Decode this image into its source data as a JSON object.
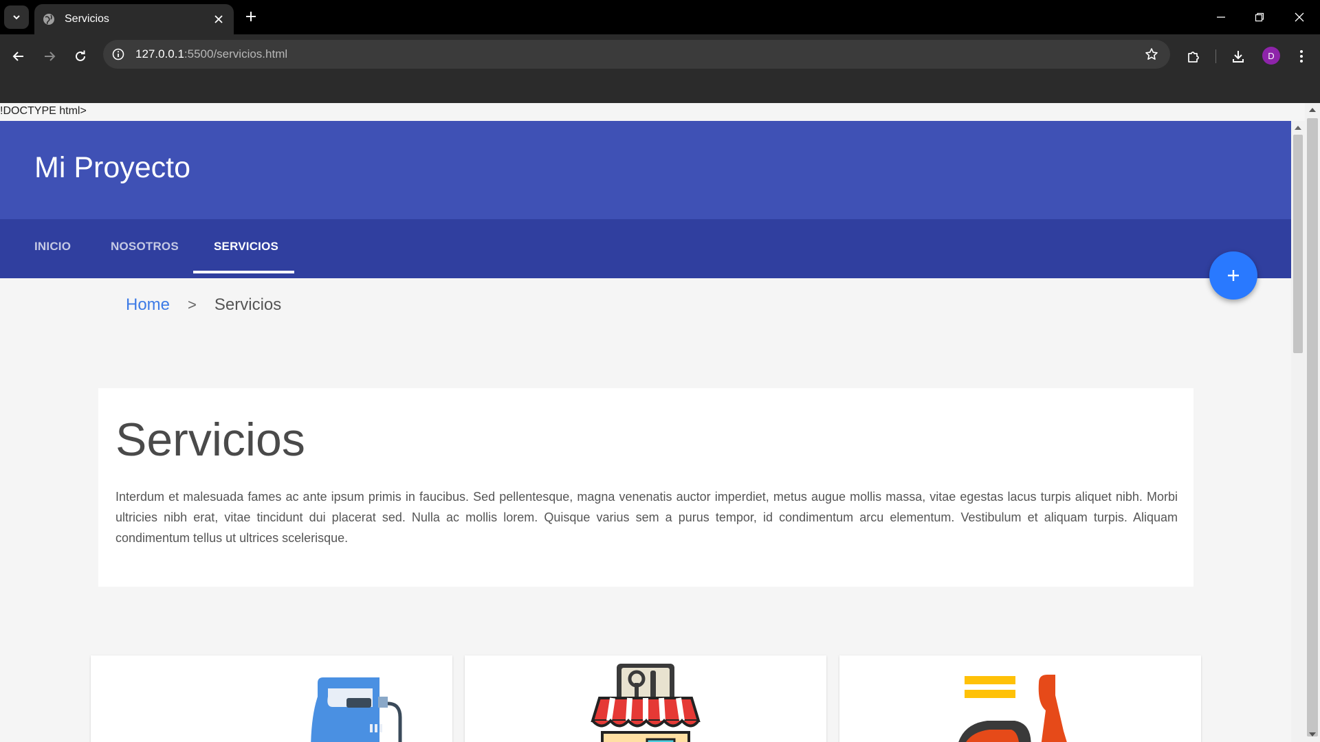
{
  "browser": {
    "tab_title": "Servicios",
    "url_host": "127.0.0.1",
    "url_rest": ":5500/servicios.html",
    "profile_initial": "D"
  },
  "page": {
    "doctype_text": "!DOCTYPE html>",
    "site_title": "Mi Proyecto",
    "nav": {
      "inicio": "INICIO",
      "nosotros": "NOSOTROS",
      "servicios": "SERVICIOS",
      "active": "SERVICIOS"
    },
    "fab_symbol": "+",
    "breadcrumb": {
      "home": "Home",
      "separator": ">",
      "current": "Servicios"
    },
    "intro": {
      "title": "Servicios",
      "text": "Interdum et malesuada fames ac ante ipsum primis in faucibus. Sed pellentesque, magna venenatis auctor imperdiet, metus augue mollis massa, vitae egestas lacus turpis aliquet nibh. Morbi ultricies nibh erat, vitae tincidunt dui placerat sed. Nulla ac mollis lorem. Quisque varius sem a purus tempor, id condimentum arcu elementum. Vestibulum et aliquam turpis. Aliquam condimentum tellus ut ultrices scelerisque."
    },
    "services": [
      {
        "icon": "iron-icon"
      },
      {
        "icon": "repair-shop-icon"
      },
      {
        "icon": "delivery-scooter-icon"
      }
    ]
  },
  "colors": {
    "header": "#3f51b5",
    "nav": "#303f9f",
    "fab": "#2979ff",
    "breadcrumb_link": "#3d7be6",
    "avatar": "#8e24aa"
  }
}
